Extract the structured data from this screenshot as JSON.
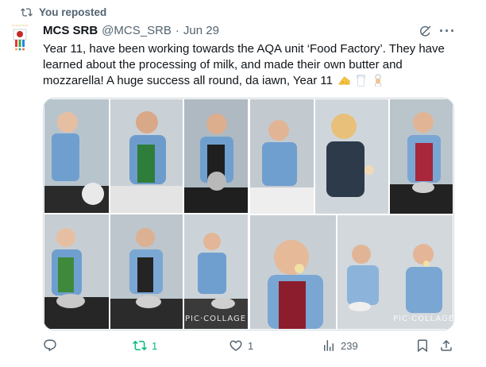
{
  "repost": {
    "label": "You reposted"
  },
  "author": {
    "name": "MCS SRB",
    "handle": "@MCS_SRB",
    "separator": "·",
    "date": "Jun 29"
  },
  "tweet": {
    "text": "Year 11, have been working towards the AQA unit ‘Food Factory’. They have learned about the processing of milk, and made their own butter and mozzarella! A huge success all round, da iawn, Year 11"
  },
  "media": {
    "watermark_left": "PIC·COLLAGE",
    "watermark_right": "PIC·COLLAGE"
  },
  "actions": {
    "reply_count": "",
    "repost_count": "1",
    "like_count": "1",
    "views_count": "239"
  },
  "colors": {
    "repost_active": "#00ba7c",
    "muted": "#536471",
    "text": "#0f1419"
  },
  "icons": [
    "repost-icon",
    "grok-icon",
    "more-icon",
    "reply-icon",
    "like-icon",
    "views-icon",
    "bookmark-icon",
    "share-icon"
  ]
}
